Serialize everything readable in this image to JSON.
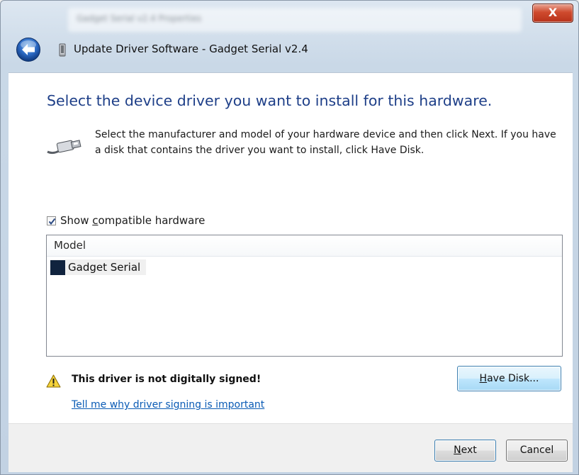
{
  "window": {
    "background_title": "Gadget Serial v2.4 Properties",
    "close_label": "X",
    "title": "Update Driver Software - Gadget Serial v2.4"
  },
  "content": {
    "heading": "Select the device driver you want to install for this hardware.",
    "instructions": "Select the manufacturer and model of your hardware device and then click Next. If you have a disk that contains the driver you want to install, click Have Disk.",
    "show_compatible": {
      "label_before": "Show ",
      "label_underlined": "c",
      "label_after": "ompatible hardware",
      "checked": true
    },
    "model_list": {
      "header": "Model",
      "items": [
        "Gadget Serial"
      ]
    },
    "warning": {
      "text": "This driver is not digitally signed!",
      "link": "Tell me why driver signing is important"
    },
    "have_disk": {
      "underlined": "H",
      "rest": "ave Disk..."
    }
  },
  "footer": {
    "next": {
      "underlined": "N",
      "rest": "ext"
    },
    "cancel": "Cancel"
  },
  "colors": {
    "heading": "#1e3f88",
    "link": "#0a5bb5",
    "selection_swatch": "#10233e",
    "close_button": "#cf4b2e"
  },
  "icons": {
    "back": "back-arrow-icon",
    "device": "usb-device-icon",
    "cable": "usb-cable-icon",
    "warning": "warning-icon",
    "checkmark": "checkmark-icon"
  }
}
